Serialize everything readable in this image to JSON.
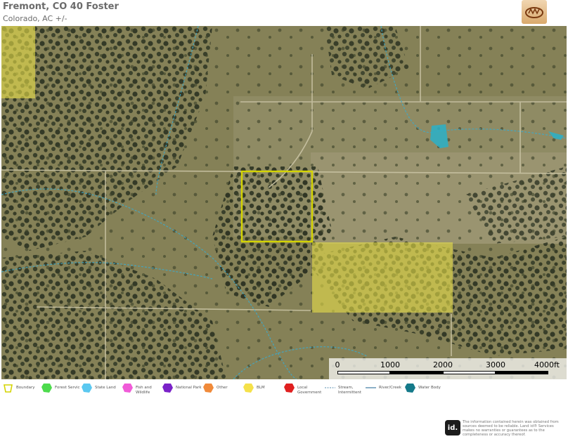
{
  "header": {
    "title": "Fremont, CO 40 Foster",
    "subtitle": "Colorado,  AC +/-"
  },
  "scale": {
    "labels": [
      "0",
      "1000",
      "2000",
      "3000",
      "4000ft"
    ]
  },
  "legend": [
    {
      "label": "Boundary",
      "icon": "boundary-icon",
      "color": "#d4d400"
    },
    {
      "label": "Forest Servic",
      "icon": "forest-service-icon",
      "color": "#4ddb4d"
    },
    {
      "label": "State Land",
      "icon": "state-land-icon",
      "color": "#5bc8f0"
    },
    {
      "label": "Fish and Wildlife",
      "icon": "fish-wildlife-icon",
      "color": "#f05bd8"
    },
    {
      "label": "National Park",
      "icon": "national-park-icon",
      "color": "#7a22c8"
    },
    {
      "label": "Other",
      "icon": "other-icon",
      "color": "#f08a3a"
    },
    {
      "label": "BLM",
      "icon": "blm-icon",
      "color": "#f5e14a"
    },
    {
      "label": "Local Government",
      "icon": "local-gov-icon",
      "color": "#e02020"
    },
    {
      "label": "Stream, Intermittent",
      "icon": "stream-icon",
      "color": "#5b8fb0"
    },
    {
      "label": "River/Creek",
      "icon": "river-icon",
      "color": "#5b8fb0"
    },
    {
      "label": "Water Body",
      "icon": "water-body-icon",
      "color": "#157a8a"
    }
  ],
  "disclaimer": {
    "logo": "id.",
    "text": "The information contained herein was obtained from sources deemed to be reliable. Land id® Services makes no warranties or guarantees as to the completeness or accuracy thereof."
  },
  "colors": {
    "boundary": "#d4d400",
    "blm_fill": "#e8e04a",
    "stream": "#3fa8c8",
    "water": "#2ab0c8"
  }
}
